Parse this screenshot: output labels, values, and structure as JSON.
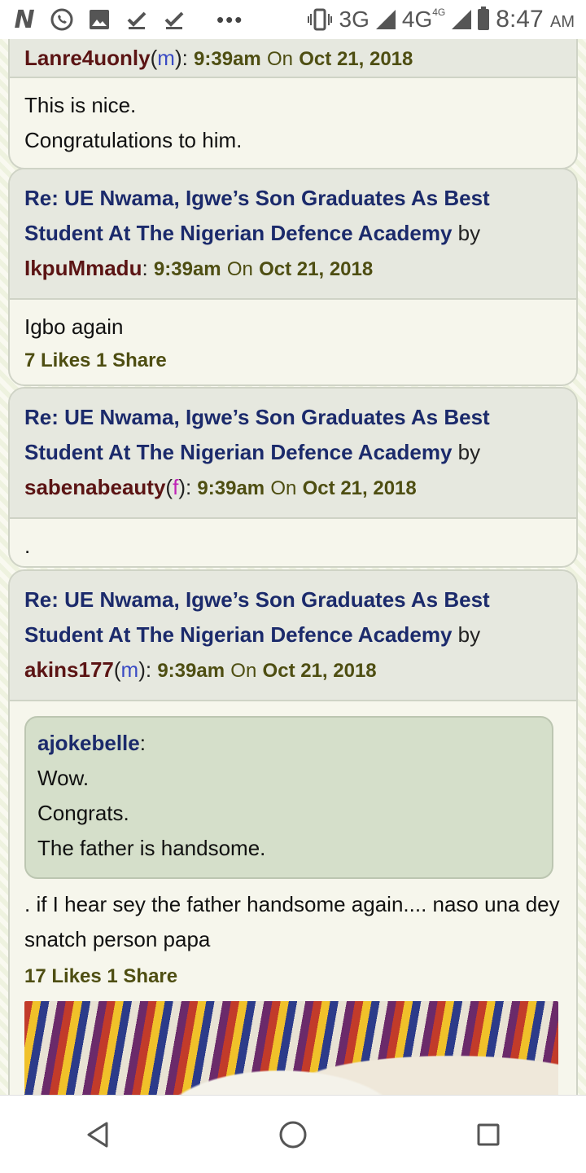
{
  "status_bar": {
    "network_3g": "3G",
    "network_4g": "4G",
    "network_4g_sup": "4G",
    "time": "8:47",
    "ampm": "AM"
  },
  "posts": [
    {
      "user": "Lanre4uonly",
      "gender": "m",
      "time": "9:39am",
      "on": "On",
      "date": "Oct 21, 2018",
      "body": [
        "This is nice.",
        "Congratulations to him."
      ]
    },
    {
      "title": "Re: UE Nwama, Igwe’s Son Graduates As Best Student At The Nigerian Defence Academy",
      "by": "by",
      "user": "IkpuMmadu",
      "time": "9:39am",
      "on": "On",
      "date": "Oct 21, 2018",
      "body": [
        "Igbo again"
      ],
      "likes": "7 Likes 1 Share"
    },
    {
      "title": "Re: UE Nwama, Igwe’s Son Graduates As Best Student At The Nigerian Defence Academy",
      "by": "by",
      "user": "sabenabeauty",
      "gender": "f",
      "time": "9:39am",
      "on": "On",
      "date": "Oct 21, 2018",
      "body": [
        "."
      ]
    },
    {
      "title": "Re: UE Nwama, Igwe’s Son Graduates As Best Student At The Nigerian Defence Academy",
      "by": "by",
      "user": "akins177",
      "gender": "m",
      "time": "9:39am",
      "on": "On",
      "date": "Oct 21, 2018",
      "quote": {
        "user": "ajokebelle",
        "lines": [
          "Wow.",
          "Congrats.",
          "The father is handsome."
        ]
      },
      "body": [
        ". if I hear sey the father handsome again.... naso una dey snatch person papa"
      ],
      "likes": "17 Likes 1 Share"
    }
  ]
}
